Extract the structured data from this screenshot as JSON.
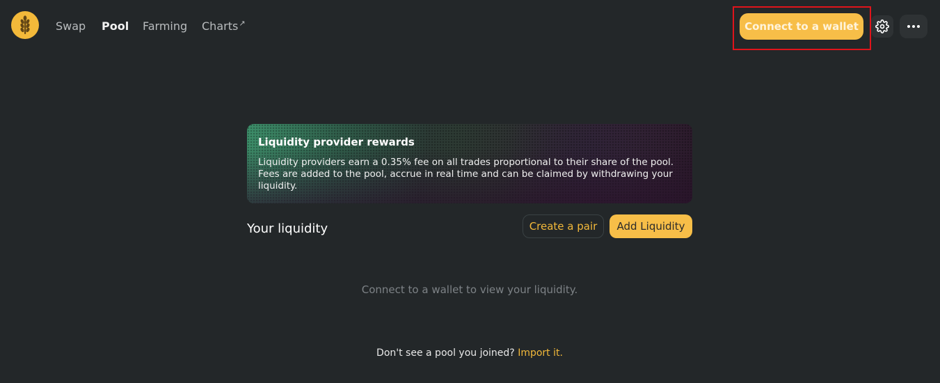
{
  "header": {
    "logo_icon": "wheat-logo-icon",
    "nav": {
      "swap": "Swap",
      "pool": "Pool",
      "farming": "Farming",
      "charts": "Charts",
      "charts_ext_icon": "↗"
    },
    "connect_wallet": "Connect to a wallet",
    "settings_icon": "gear-icon",
    "more_icon": "more-dots-icon"
  },
  "banner": {
    "title": "Liquidity provider rewards",
    "text": "Liquidity providers earn a 0.35% fee on all trades proportional to their share of the pool. Fees are added to the pool, accrue in real time and can be claimed by withdrawing your liquidity."
  },
  "liquidity": {
    "title": "Your liquidity",
    "create_pair": "Create a pair",
    "add_liquidity": "Add Liquidity",
    "empty_message": "Connect to a wallet to view your liquidity."
  },
  "footer": {
    "prompt": "Don't see a pool you joined?",
    "import_link": "Import it."
  },
  "colors": {
    "background": "#232729",
    "accent": "#f7be48",
    "highlight": "#e0141b"
  }
}
